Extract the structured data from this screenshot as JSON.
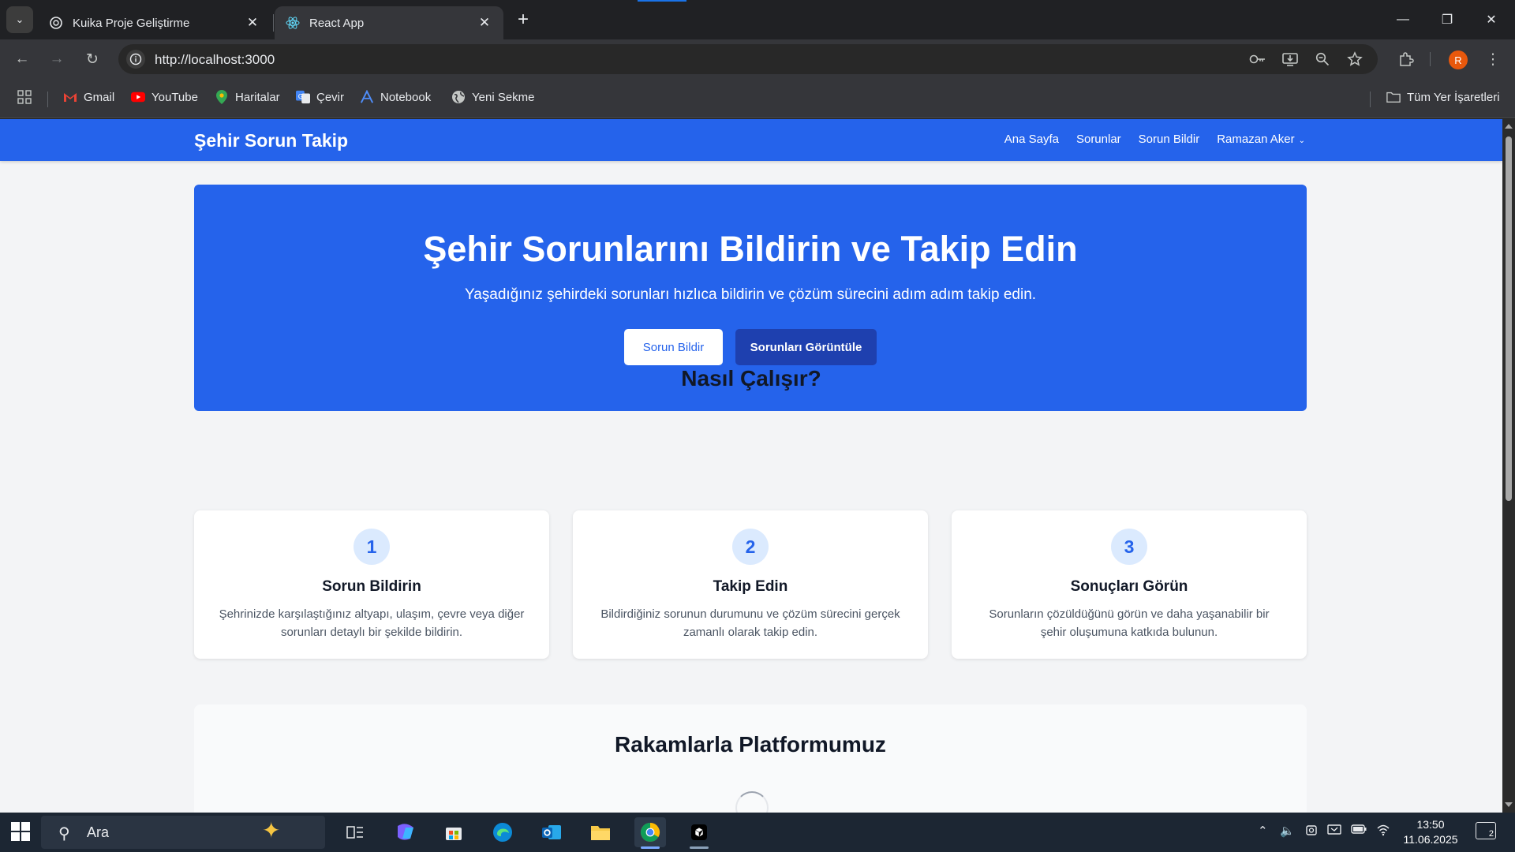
{
  "browser": {
    "tabs": [
      {
        "title": "Kuika Proje Geliştirme",
        "active": false
      },
      {
        "title": "React App",
        "active": true
      }
    ],
    "url": "http://localhost:3000",
    "profile_initial": "R",
    "bookmarks": [
      "Gmail",
      "YouTube",
      "Haritalar",
      "Çevir",
      "Notebook",
      "Yeni Sekme"
    ],
    "all_bookmarks_label": "Tüm Yer İşaretleri"
  },
  "page": {
    "brand": "Şehir Sorun Takip",
    "nav": {
      "home": "Ana Sayfa",
      "issues": "Sorunlar",
      "report": "Sorun Bildir",
      "user": "Ramazan Aker"
    },
    "hero": {
      "title": "Şehir Sorunlarını Bildirin ve Takip Edin",
      "subtitle": "Yaşadığınız şehirdeki sorunları hızlıca bildirin ve çözüm sürecini adım adım takip edin.",
      "primary_button": "Sorun Bildir",
      "secondary_button": "Sorunları Görüntüle"
    },
    "how_it_works": {
      "title": "Nasıl Çalışır?",
      "steps": [
        {
          "number": "1",
          "title": "Sorun Bildirin",
          "text": "Şehrinizde karşılaştığınız altyapı, ulaşım, çevre veya diğer sorunları detaylı bir şekilde bildirin."
        },
        {
          "number": "2",
          "title": "Takip Edin",
          "text": "Bildirdiğiniz sorunun durumunu ve çözüm sürecini gerçek zamanlı olarak takip edin."
        },
        {
          "number": "3",
          "title": "Sonuçları Görün",
          "text": "Sorunların çözüldüğünü görün ve daha yaşanabilir bir şehir oluşumuna katkıda bulunun."
        }
      ]
    },
    "stats": {
      "title": "Rakamlarla Platformumuz"
    }
  },
  "taskbar": {
    "search_label": "Ara",
    "time": "13:50",
    "date": "11.06.2025",
    "notification_count": "2"
  },
  "colors": {
    "brand_blue": "#2563eb",
    "dark_blue": "#1e40af",
    "step_bg": "#dbeafe",
    "page_bg": "#f3f4f6"
  }
}
